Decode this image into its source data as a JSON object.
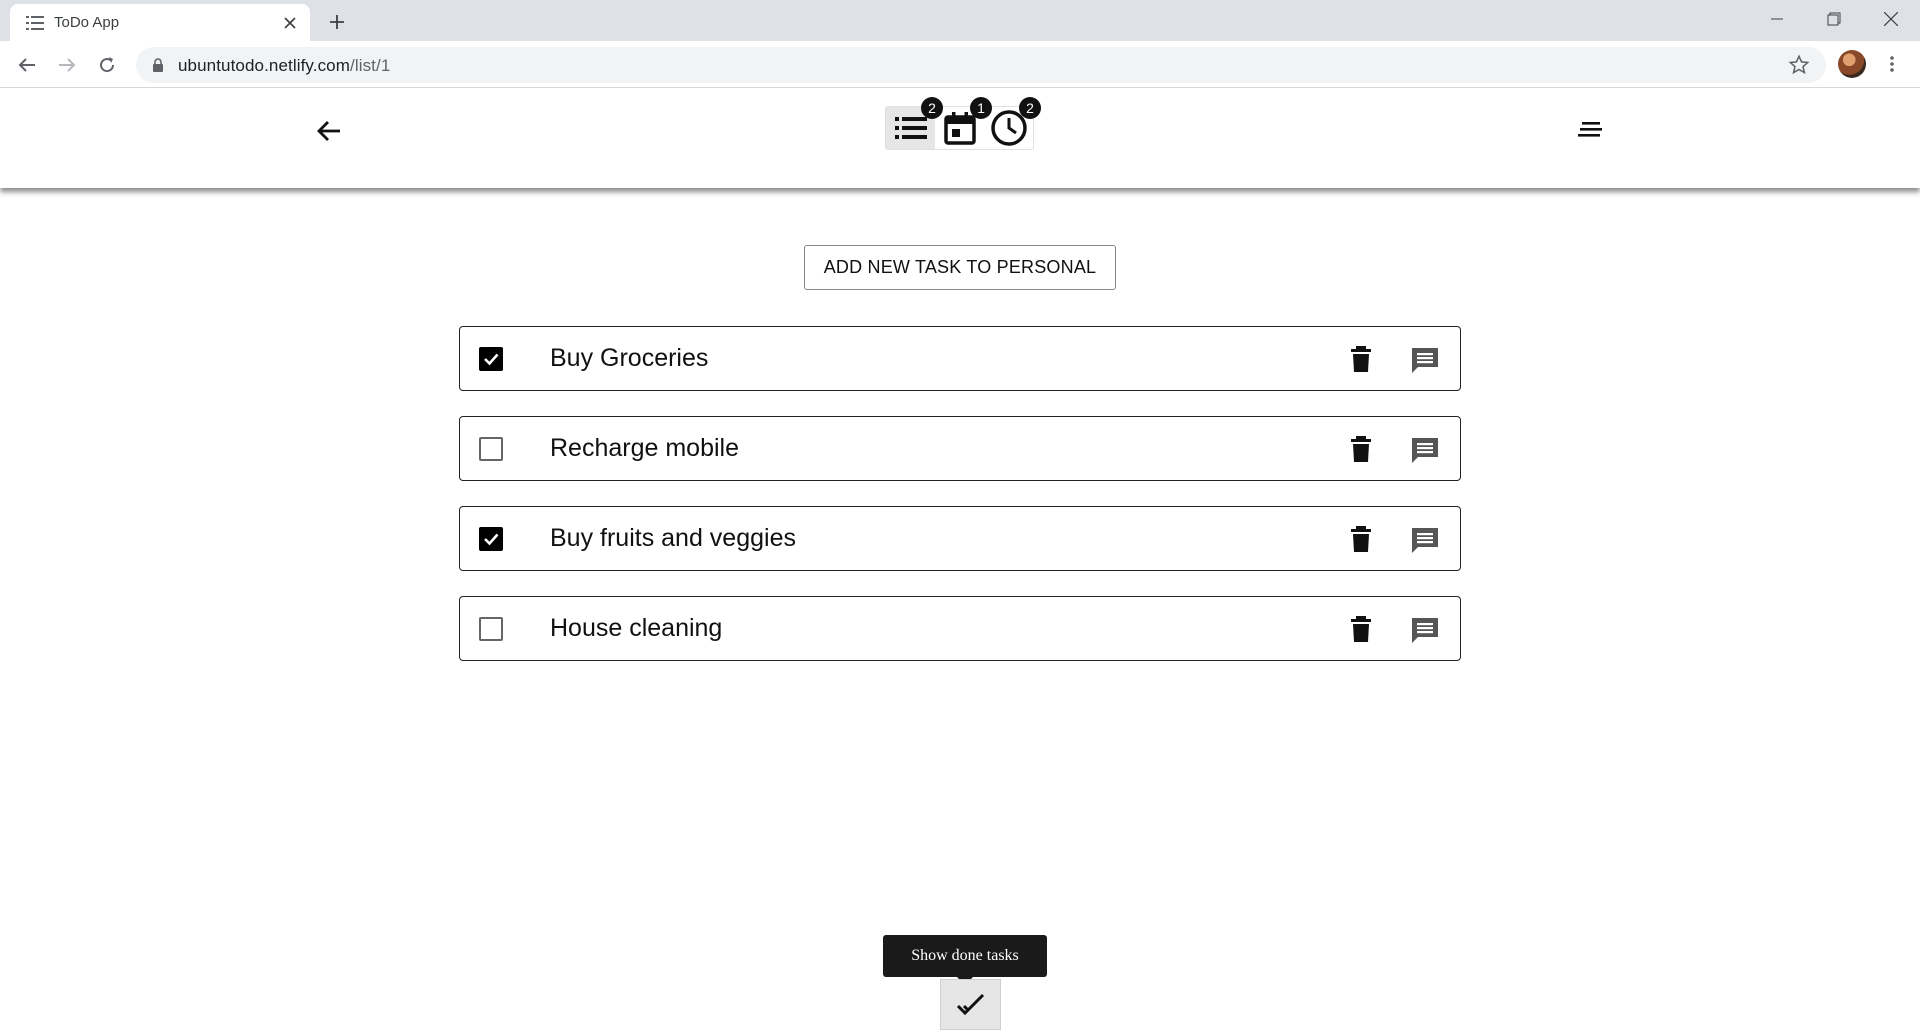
{
  "browser": {
    "tab_title": "ToDo App",
    "url_host": "ubuntutodo.netlify.com",
    "url_path": "/list/1",
    "icons": [
      "list-favicon-icon",
      "close-icon",
      "plus-icon",
      "minimize-icon",
      "restore-icon",
      "window-close-icon",
      "back-icon",
      "forward-icon",
      "reload-icon",
      "lock-icon",
      "star-icon",
      "kebab-icon"
    ]
  },
  "header": {
    "views": [
      {
        "name": "list-view",
        "icon": "list-icon",
        "badge": "2",
        "active": true
      },
      {
        "name": "calendar-view",
        "icon": "calendar-icon",
        "badge": "1",
        "active": false
      },
      {
        "name": "clock-view",
        "icon": "clock-icon",
        "badge": "2",
        "active": false
      }
    ]
  },
  "main": {
    "add_task_label": "ADD NEW TASK TO PERSONAL",
    "tasks": [
      {
        "label": "Buy Groceries",
        "done": true
      },
      {
        "label": "Recharge mobile",
        "done": false
      },
      {
        "label": "Buy fruits and veggies",
        "done": true
      },
      {
        "label": "House cleaning",
        "done": false
      }
    ]
  },
  "footer": {
    "tooltip": "Show done tasks"
  },
  "colors": {
    "tabstrip": "#dee1e6",
    "tooltip_bg": "#1a1a1a",
    "badge_bg": "#111111"
  }
}
